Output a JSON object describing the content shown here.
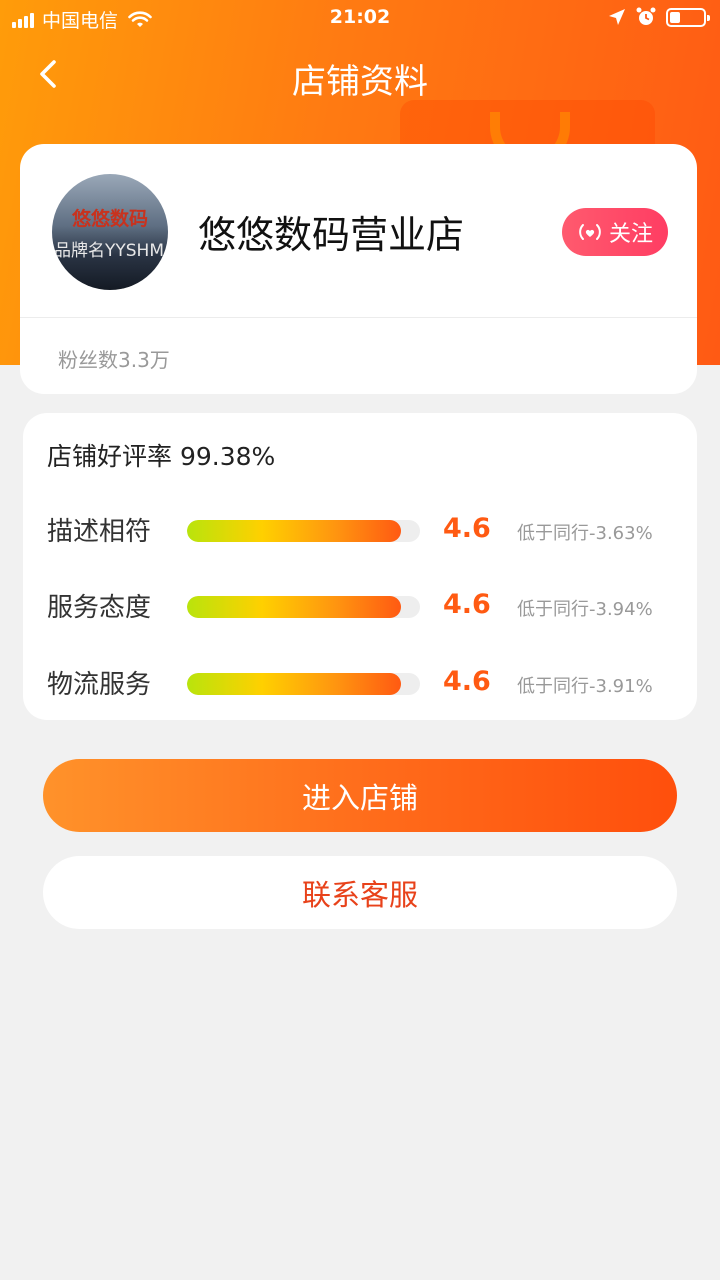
{
  "status_bar": {
    "carrier": "中国电信",
    "time": "21:02"
  },
  "nav": {
    "title": "店铺资料"
  },
  "store": {
    "avatar_text_top": "悠悠数码",
    "avatar_text_bottom": "品牌名YYSHM",
    "name": "悠悠数码营业店",
    "follow_label": "关注",
    "fans": "粉丝数3.3万"
  },
  "ratings": {
    "title": "店铺好评率 99.38%",
    "items": [
      {
        "label": "描述相符",
        "score": "4.6",
        "compare": "低于同行-3.63%",
        "fill": 0.92
      },
      {
        "label": "服务态度",
        "score": "4.6",
        "compare": "低于同行-3.94%",
        "fill": 0.92
      },
      {
        "label": "物流服务",
        "score": "4.6",
        "compare": "低于同行-3.91%",
        "fill": 0.92
      }
    ]
  },
  "actions": {
    "enter_store": "进入店铺",
    "contact_service": "联系客服"
  },
  "colors": {
    "accent": "#ff5a12",
    "follow": "#ff3d63",
    "contact_text": "#e8421a"
  }
}
